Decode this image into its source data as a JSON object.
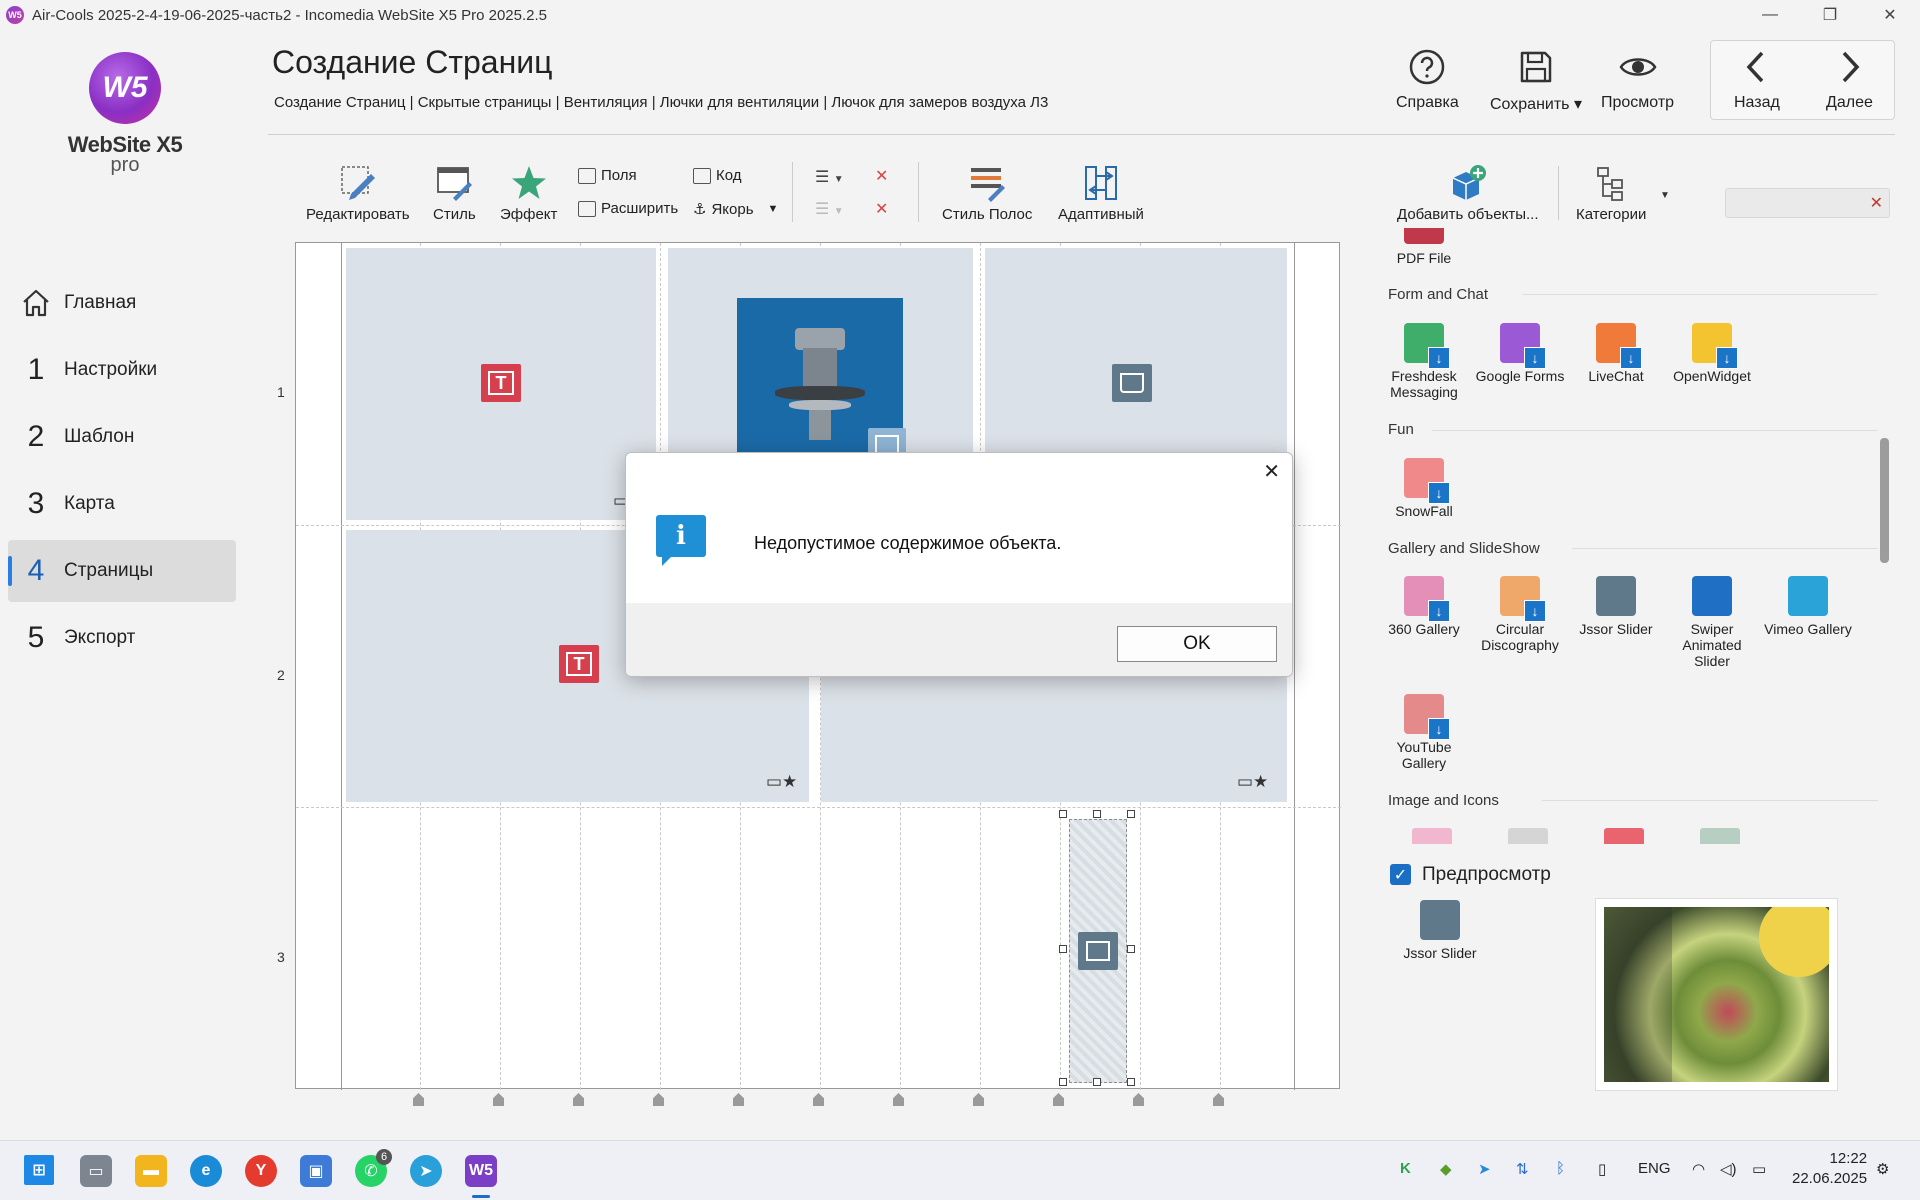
{
  "window": {
    "title": "Air-Cools 2025-2-4-19-06-2025-часть2 - Incomedia WebSite X5 Pro 2025.2.5",
    "app_icon": "W5",
    "minimize": "—",
    "restore": "❐",
    "close": "✕"
  },
  "logo": {
    "mark": "W5",
    "name": "WebSite X5",
    "edition": "pro"
  },
  "sidebar": {
    "items": [
      {
        "num": "",
        "label": "Главная",
        "icon": "house-icon"
      },
      {
        "num": "1",
        "label": "Настройки"
      },
      {
        "num": "2",
        "label": "Шаблон"
      },
      {
        "num": "3",
        "label": "Карта"
      },
      {
        "num": "4",
        "label": "Страницы",
        "active": true
      },
      {
        "num": "5",
        "label": "Экспорт"
      }
    ]
  },
  "header": {
    "title": "Создание Страниц",
    "breadcrumb": "Создание Страниц | Скрытые страницы | Вентиляция | Лючки для вентиляции | Лючок для замеров воздуха Л3",
    "help": "Справка",
    "save": "Сохранить",
    "preview": "Просмотр",
    "back": "Назад",
    "next": "Далее"
  },
  "toolbar": {
    "edit": "Редактировать",
    "style": "Стиль",
    "effect": "Эффект",
    "fields": "Поля",
    "expand": "Расширить",
    "code": "Код",
    "anchor": "Якорь",
    "band_style": "Стиль Полос",
    "adaptive": "Адаптивный",
    "add_objects": "Добавить объекты...",
    "categories": "Категории",
    "search_placeholder": ""
  },
  "canvas": {
    "rows": [
      "1",
      "2",
      "3"
    ]
  },
  "objects_panel": {
    "top_item": "PDF File",
    "categories": [
      {
        "name": "Form and Chat",
        "items": [
          "Freshdesk Messaging",
          "Google Forms",
          "LiveChat",
          "OpenWidget"
        ]
      },
      {
        "name": "Fun",
        "items": [
          "SnowFall"
        ]
      },
      {
        "name": "Gallery and SlideShow",
        "items": [
          "360 Gallery",
          "Circular Discography",
          "Jssor Slider",
          "Swiper Animated Slider",
          "Vimeo Gallery",
          "YouTube Gallery"
        ]
      },
      {
        "name": "Image and Icons",
        "items": []
      }
    ],
    "colors": {
      "download_badge": "#1a74c7",
      "freshdesk": "#3fae6a",
      "google_forms": "#9b59d6",
      "livechat": "#f07a3a",
      "openwidget": "#f4c430"
    }
  },
  "preview": {
    "checkbox_label": "Предпросмотр",
    "checked": true,
    "object_name": "Jssor Slider"
  },
  "dialog": {
    "message": "Недопустимое содержимое объекта.",
    "ok": "OK",
    "close": "✕",
    "icon": "info-icon"
  },
  "taskbar": {
    "whatsapp_badge": "6",
    "lang": "ENG",
    "time": "12:22",
    "date": "22.06.2025"
  }
}
